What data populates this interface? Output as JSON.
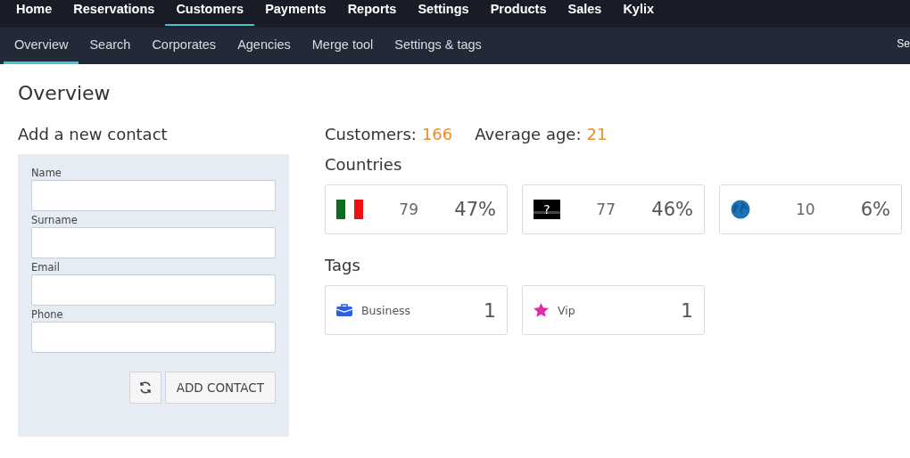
{
  "main_nav": [
    {
      "label": "Home",
      "selected": false
    },
    {
      "label": "Reservations",
      "selected": false
    },
    {
      "label": "Customers",
      "selected": true
    },
    {
      "label": "Payments",
      "selected": false
    },
    {
      "label": "Reports",
      "selected": false
    },
    {
      "label": "Settings",
      "selected": false
    },
    {
      "label": "Products",
      "selected": false
    },
    {
      "label": "Sales",
      "selected": false
    },
    {
      "label": "Kylix",
      "selected": false
    }
  ],
  "sub_nav": [
    {
      "label": "Overview",
      "selected": true
    },
    {
      "label": "Search",
      "selected": false
    },
    {
      "label": "Corporates",
      "selected": false
    },
    {
      "label": "Agencies",
      "selected": false
    },
    {
      "label": "Merge tool",
      "selected": false
    },
    {
      "label": "Settings & tags",
      "selected": false
    }
  ],
  "sub_nav_right": "Se",
  "page_title": "Overview",
  "form": {
    "title": "Add a new contact",
    "fields": [
      {
        "label": "Name"
      },
      {
        "label": "Surname"
      },
      {
        "label": "Email"
      },
      {
        "label": "Phone"
      }
    ],
    "submit": "ADD CONTACT"
  },
  "stats": [
    {
      "label": "Customers:",
      "value": "166"
    },
    {
      "label": "Average age:",
      "value": "21"
    }
  ],
  "countries_title": "Countries",
  "countries": [
    {
      "kind": "italy",
      "count": "79",
      "percent": "47%"
    },
    {
      "kind": "unknown",
      "flag_label": "?",
      "count": "77",
      "percent": "46%"
    },
    {
      "kind": "world",
      "count": "10",
      "percent": "6%"
    }
  ],
  "tags_title": "Tags",
  "tags": [
    {
      "kind": "briefcase",
      "label": "Business",
      "count": "1"
    },
    {
      "kind": "star",
      "label": "Vip",
      "count": "1"
    }
  ]
}
